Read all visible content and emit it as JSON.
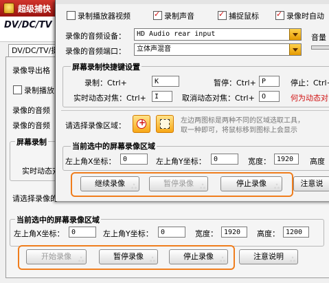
{
  "back": {
    "title": "超级捕快",
    "header_label": "DV/DC/TV",
    "tab_label": "DV/DC/TV/摄",
    "export_label": "录像导出格",
    "record_playback_label": "录制播放",
    "audio_device_label": "录像的音频",
    "audio_port_label": "录像的音频",
    "hotkey_group_title": "屏幕录制",
    "realtime_focus_label": "实时动态对",
    "select_region_label": "请选择录像的",
    "region_group_title": "当前选中的屏幕录像区域",
    "top_left_x_label": "左上角X坐标：",
    "top_left_x_value": "0",
    "top_left_y_label": "左上角Y坐标：",
    "top_left_y_value": "0",
    "width_label": "宽度：",
    "width_value": "1920",
    "height_label": "高度：",
    "height_value": "1200",
    "start_button": "开始录像",
    "pause_button": "暂停录像",
    "stop_button": "停止录像",
    "notes_button": "注意说明"
  },
  "front": {
    "checkbox_record_video": "录制播放器视频",
    "checkbox_record_sound": "录制声音",
    "checkbox_capture_mouse": "捕捉鼠标",
    "checkbox_auto": "录像时自动",
    "audio_device_label": "录像的音频设备：",
    "audio_device_value": "HD Audio rear input",
    "audio_port_label": "录像的音频端口：",
    "audio_port_value": "立体声混音",
    "volume_label": "音量",
    "hotkey_group_title": "屏幕录制快捷键设置",
    "record_label": "录制：Ctrl+",
    "record_key": "K",
    "pause_label": "暂停：Ctrl+",
    "pause_key": "P",
    "stop_label": "停止：Ctrl+",
    "realtime_focus_label": "实时动态对焦：Ctrl+",
    "realtime_focus_key": "I",
    "cancel_focus_label": "取消动态对焦：Ctrl+",
    "cancel_focus_key": "O",
    "dynamic_focus_hint": "何为动态对",
    "select_region_label": "请选择录像区域：",
    "region_hint_line1": "左边两图标是两种不同的区域选取工具，",
    "region_hint_line2": "取一种即可，将鼠标移到图标上会显示",
    "region_group_title": "当前选中的屏幕录像区域",
    "top_left_x_label": "左上角X坐标：",
    "top_left_x_value": "0",
    "top_left_y_label": "左上角Y坐标：",
    "top_left_y_value": "0",
    "width_label": "宽度：",
    "width_value": "1920",
    "height_label": "高度",
    "continue_button": "继续录像",
    "pause_button": "暂停录像",
    "stop_button": "停止录像",
    "notes_button": "注意说"
  },
  "colors": {
    "accent_red": "#d01010",
    "highlight_orange": "#f07d1c",
    "titlebar_red": "#b81f18"
  }
}
